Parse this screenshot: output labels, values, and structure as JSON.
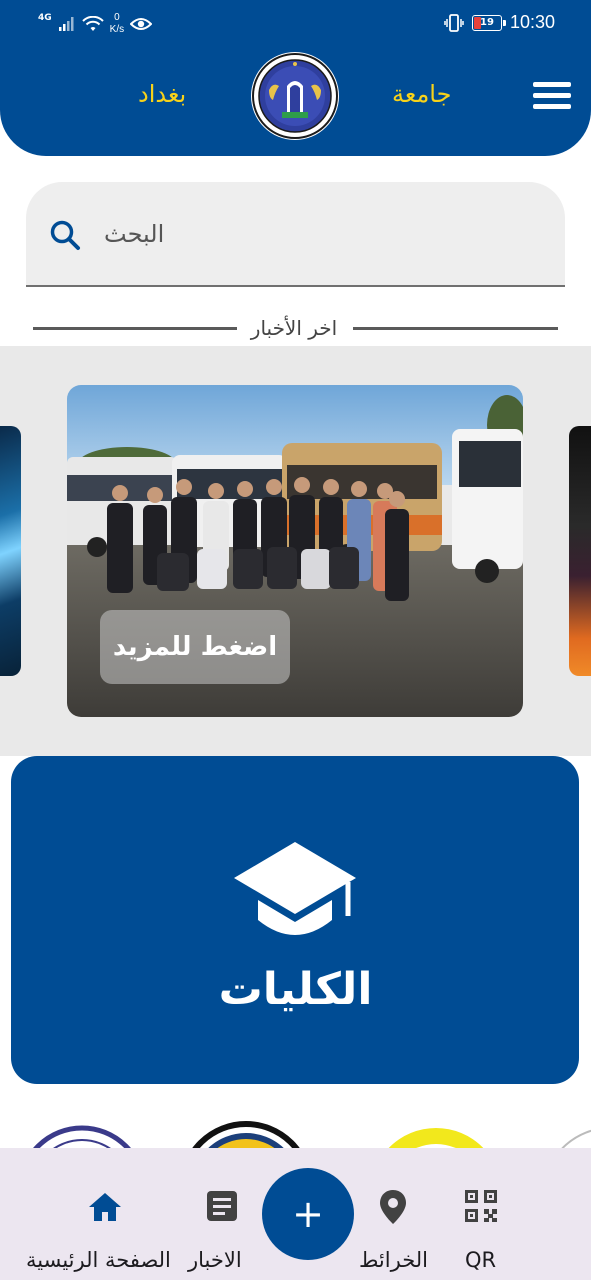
{
  "status_bar": {
    "network_type": "4G",
    "speed_value": "0",
    "speed_unit": "K/s",
    "battery_level": "19",
    "time": "10:30"
  },
  "header": {
    "title_right": "جامعة",
    "title_left": "بغداد",
    "menu_icon": "hamburger-menu-icon",
    "logo_icon": "university-of-baghdad-logo"
  },
  "search": {
    "placeholder": "البحث",
    "icon": "search-icon"
  },
  "news": {
    "section_title": "اخر الأخبار",
    "more_button_label": "اضغط للمزيد"
  },
  "colleges": {
    "label": "الكليات",
    "icon": "graduation-cap-icon"
  },
  "bottom_nav": {
    "items": [
      {
        "label": "الصفحة الرئيسية",
        "icon": "home-icon"
      },
      {
        "label": "الاخبار",
        "icon": "article-icon"
      },
      {
        "label": "الخرائط",
        "icon": "location-pin-icon"
      },
      {
        "label": "QR",
        "icon": "qr-code-icon"
      }
    ],
    "fab_label": "+"
  },
  "colors": {
    "primary": "#004c94",
    "accent_yellow": "#f7d21a",
    "nav_background": "#ece6f0",
    "band_background": "#e9e9e9"
  }
}
